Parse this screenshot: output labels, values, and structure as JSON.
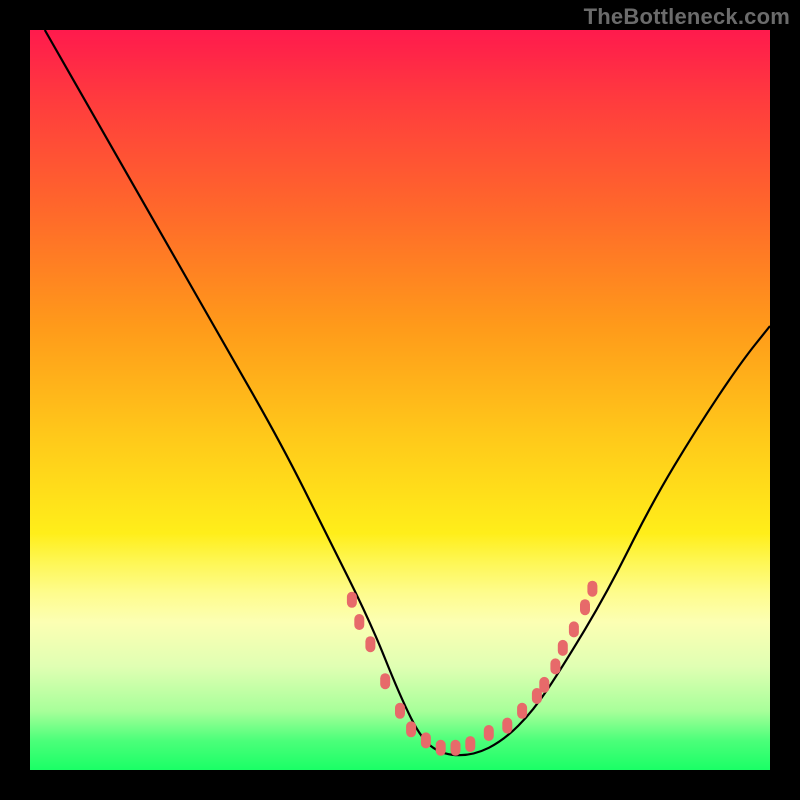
{
  "watermark": "TheBottleneck.com",
  "chart_data": {
    "type": "line",
    "title": "",
    "xlabel": "",
    "ylabel": "",
    "xlim": [
      0,
      1
    ],
    "ylim": [
      0,
      1
    ],
    "series": [
      {
        "name": "curve",
        "x": [
          0.02,
          0.1,
          0.18,
          0.26,
          0.34,
          0.4,
          0.46,
          0.5,
          0.53,
          0.56,
          0.6,
          0.64,
          0.68,
          0.72,
          0.78,
          0.84,
          0.9,
          0.96,
          1.0
        ],
        "y": [
          1.0,
          0.86,
          0.72,
          0.58,
          0.44,
          0.32,
          0.2,
          0.1,
          0.04,
          0.02,
          0.02,
          0.04,
          0.08,
          0.14,
          0.24,
          0.36,
          0.46,
          0.55,
          0.6
        ]
      }
    ],
    "markers": {
      "name": "highlighted-points",
      "x": [
        0.435,
        0.445,
        0.46,
        0.48,
        0.5,
        0.515,
        0.535,
        0.555,
        0.575,
        0.595,
        0.62,
        0.645,
        0.665,
        0.685,
        0.695,
        0.71,
        0.72,
        0.735,
        0.75,
        0.76
      ],
      "y": [
        0.23,
        0.2,
        0.17,
        0.12,
        0.08,
        0.055,
        0.04,
        0.03,
        0.03,
        0.035,
        0.05,
        0.06,
        0.08,
        0.1,
        0.115,
        0.14,
        0.165,
        0.19,
        0.22,
        0.245
      ]
    }
  }
}
